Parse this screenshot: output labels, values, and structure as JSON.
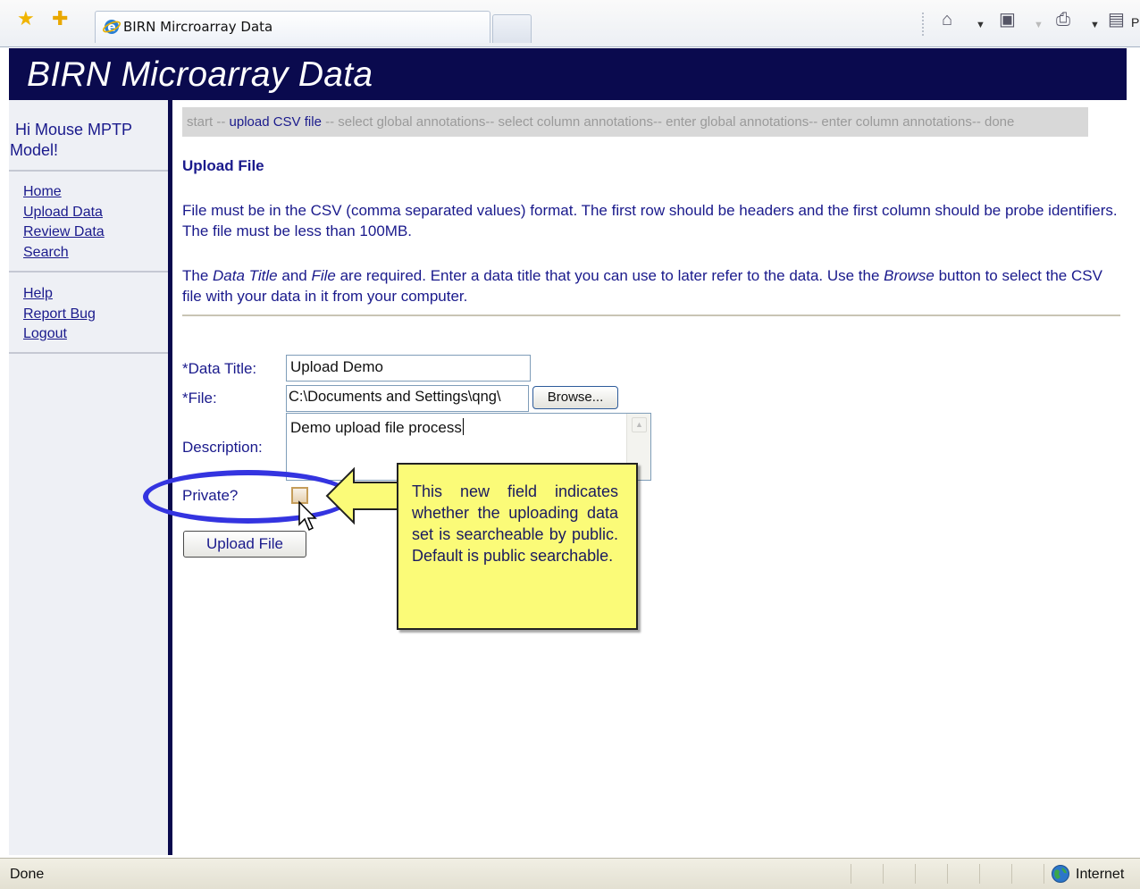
{
  "browser": {
    "tab_title": "BIRN Mircroarray Data",
    "page_menu_label": "P",
    "status": "Done",
    "zone": "Internet"
  },
  "header": {
    "title": "BIRN Microarray Data"
  },
  "sidebar": {
    "greeting_line1": "Hi Mouse MPTP",
    "greeting_line2": "Model!",
    "nav": [
      "Home",
      "Upload Data",
      "Review Data",
      "Search"
    ],
    "help": [
      "Help",
      "Report Bug",
      "Logout"
    ]
  },
  "wizard": {
    "start": "start --",
    "current": " upload CSV file ",
    "rest": "-- select global annotations-- select column annotations-- enter global annotations-- enter column annotations-- done"
  },
  "page": {
    "title": "Upload File",
    "para1": "File must be in the CSV (comma separated values) format. The first row should be headers and the first column should be probe identifiers. The file must be less than 100MB.",
    "para2_a": "The ",
    "para2_data_title": "Data Title",
    "para2_b": " and ",
    "para2_file": "File",
    "para2_c": " are required. Enter a data title that you can use to later refer to the data. Use the ",
    "para2_browse": "Browse",
    "para2_d": " button to select the CSV file with your data in it from your computer."
  },
  "form": {
    "data_title_label": "*Data Title:",
    "data_title_value": "Upload Demo",
    "file_label": "*File:",
    "file_value": "C:\\Documents and Settings\\qng\\",
    "browse_label": "Browse...",
    "description_label": "Description:",
    "description_value": "Demo upload file process",
    "private_label": "Private?",
    "private_checked": false,
    "upload_button": "Upload File"
  },
  "callout": {
    "text": "This new field indicates whether the uploading data set is searcheable by public. Default is public searchable."
  },
  "colors": {
    "header_bg": "#0a0a4e",
    "text": "#1a1a8c",
    "callout_bg": "#fbfb78",
    "ellipse": "#3434e0"
  }
}
